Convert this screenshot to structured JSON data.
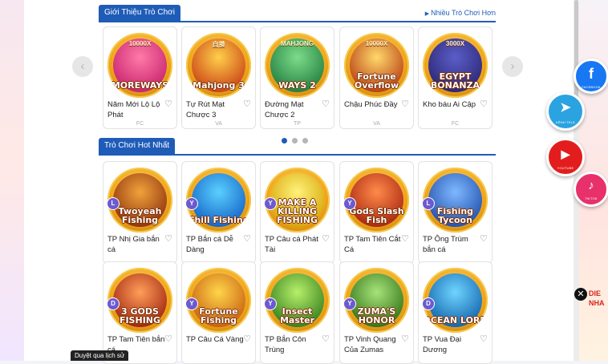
{
  "intro_section": {
    "title": "Giới Thiệu Trò Chơi",
    "more_link": "Nhiều Trò Chơi Hơn",
    "games": [
      {
        "name": "Năm Mới Lộ Lộ Phát",
        "provider": "FC",
        "logo": "MOREWAYS",
        "top": "10000X",
        "colors": [
          "#ff7aa8",
          "#c51f6b"
        ]
      },
      {
        "name": "Tự Rút Mạt Chược 3",
        "provider": "VA",
        "logo": "Mahjong 3",
        "top": "自摸",
        "colors": [
          "#ffcf4a",
          "#c73b13"
        ]
      },
      {
        "name": "Đường Mạt Chược 2",
        "provider": "TP",
        "logo": "WAYS 2",
        "top": "MAHJONG",
        "colors": [
          "#7ddc8a",
          "#1d7a3d"
        ]
      },
      {
        "name": "Chậu Phúc Đầy",
        "provider": "VA",
        "logo": "Fortune Overflow",
        "top": "10000X",
        "colors": [
          "#ffd86b",
          "#b4370f"
        ]
      },
      {
        "name": "Kho báu Ai Cập",
        "provider": "FC",
        "logo": "EGYPT BONANZA",
        "top": "3000X",
        "colors": [
          "#5b5ec9",
          "#2a2470"
        ]
      }
    ]
  },
  "hot_section": {
    "title": "Trò Chơi Hot Nhất",
    "games": [
      {
        "name": "TP Nhị Gia bắn cá",
        "badge": "L",
        "logo": "Twoyeah Fishing",
        "colors": [
          "#f0a33a",
          "#8a2b0d"
        ]
      },
      {
        "name": "TP Bắn cá Dễ Dàng",
        "badge": "Y",
        "logo": "Chill Fishing",
        "colors": [
          "#5ad0ff",
          "#115ec4"
        ]
      },
      {
        "name": "TP Câu cá Phát Tài",
        "badge": "Y",
        "logo": "MAKE A KILLING FISHING",
        "colors": [
          "#fff27a",
          "#d4a100"
        ]
      },
      {
        "name": "TP Tam Tiên Cắt Cá",
        "badge": "Y",
        "logo": "Gods Slash Fish",
        "colors": [
          "#ff8a4a",
          "#a3210d"
        ]
      },
      {
        "name": "TP Ông Trùm bắn cá",
        "badge": "L",
        "logo": "Fishing Tycoon",
        "colors": [
          "#7fb8ff",
          "#1c4ba8"
        ]
      },
      {
        "name": "TP Tam Tiên bắn cá",
        "badge": "D",
        "logo": "3 GODS FISHING",
        "colors": [
          "#ff9e5a",
          "#9a1e0b"
        ]
      },
      {
        "name": "TP Câu Cá Vàng",
        "badge": "Y",
        "logo": "Fortune Fishing",
        "colors": [
          "#ffd54a",
          "#c4590d"
        ]
      },
      {
        "name": "TP Bắn Côn Trùng",
        "badge": "Y",
        "logo": "Insect Master",
        "colors": [
          "#b7ef6a",
          "#2e7a1a"
        ]
      },
      {
        "name": "TP Vinh Quang Của Zumas",
        "badge": "Y",
        "logo": "ZUMA'S HONOR",
        "colors": [
          "#a6e37a",
          "#2c6d12"
        ]
      },
      {
        "name": "TP Vua Đại Dương",
        "badge": "D",
        "logo": "OCEAN LORD",
        "colors": [
          "#6fd4ff",
          "#0d5fa8"
        ]
      }
    ]
  },
  "social": [
    {
      "label": "FACEBOOK",
      "glyph": "f",
      "color": "#1877f2"
    },
    {
      "label": "KÊNH TELE",
      "glyph": "➤",
      "color": "#2aa3e0"
    },
    {
      "label": "YOUTUBE",
      "glyph": "▶",
      "color": "#e31d1d"
    },
    {
      "label": "TIKTOK",
      "glyph": "♪",
      "color": "#e8306a"
    }
  ],
  "promo_text": [
    "DIE",
    "NHA"
  ],
  "tooltip": "Duyệt qua lịch sử",
  "close_symbol": "✕",
  "heart_symbol": "♡",
  "prev_symbol": "‹",
  "next_symbol": "›"
}
